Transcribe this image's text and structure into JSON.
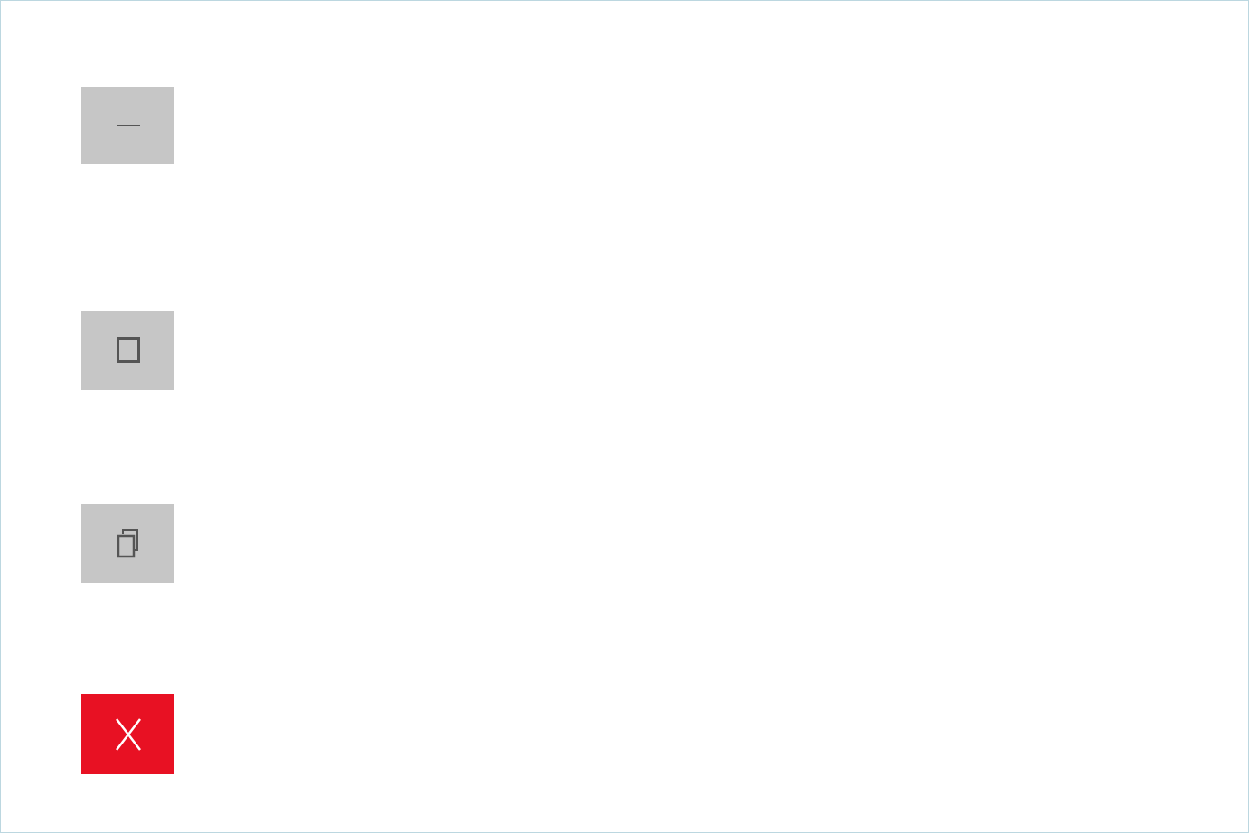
{
  "caption_buttons": [
    {
      "icon": "minimize-icon",
      "background": "#c6c6c6",
      "glyph_color": "#555555"
    },
    {
      "icon": "maximize-icon",
      "background": "#c6c6c6",
      "glyph_color": "#555555"
    },
    {
      "icon": "restore-icon",
      "background": "#c6c6c6",
      "glyph_color": "#555555"
    },
    {
      "icon": "close-icon",
      "background": "#e81123",
      "glyph_color": "#ffffff"
    }
  ]
}
